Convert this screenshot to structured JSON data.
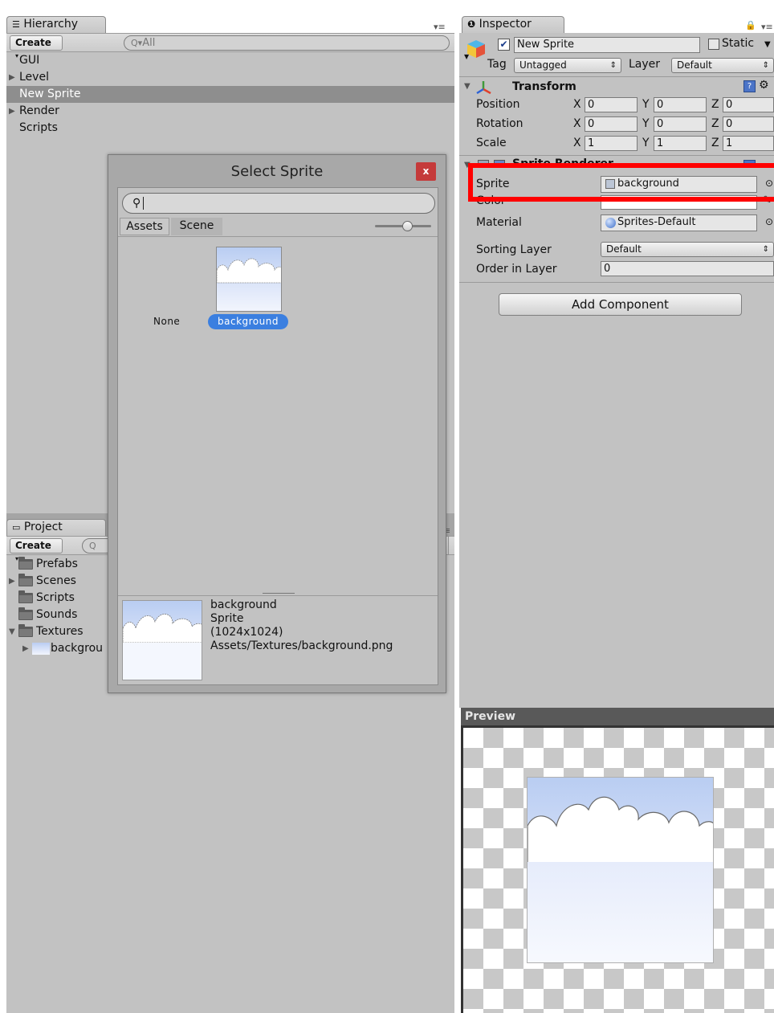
{
  "hierarchy": {
    "tab_label": "Hierarchy",
    "create_label": "Create",
    "search_placeholder": "All",
    "items": [
      {
        "label": "GUI",
        "has_children": false,
        "selected": false
      },
      {
        "label": "Level",
        "has_children": true,
        "selected": false
      },
      {
        "label": "New Sprite",
        "has_children": false,
        "selected": true
      },
      {
        "label": "Render",
        "has_children": true,
        "selected": false
      },
      {
        "label": "Scripts",
        "has_children": false,
        "selected": false
      }
    ]
  },
  "project": {
    "tab_label": "Project",
    "create_label": "Create",
    "folders": [
      {
        "label": "Prefabs",
        "expanded": null
      },
      {
        "label": "Scenes",
        "expanded": false
      },
      {
        "label": "Scripts",
        "expanded": null
      },
      {
        "label": "Sounds",
        "expanded": null
      },
      {
        "label": "Textures",
        "expanded": true
      }
    ],
    "child_asset": "backgrou"
  },
  "dialog": {
    "title": "Select Sprite",
    "close_label": "x",
    "search_value": "",
    "tabs": [
      "Assets",
      "Scene"
    ],
    "active_tab": "Scene",
    "none_label": "None",
    "selected_label": "background",
    "info": {
      "name": "background",
      "type": "Sprite",
      "size": "(1024x1024)",
      "path": "Assets/Textures/background.png"
    }
  },
  "inspector": {
    "tab_label": "Inspector",
    "object_active": true,
    "object_name": "New Sprite",
    "static_label": "Static",
    "static_checked": false,
    "tag_label": "Tag",
    "tag_value": "Untagged",
    "layer_label": "Layer",
    "layer_value": "Default",
    "transform": {
      "title": "Transform",
      "rows": [
        {
          "label": "Position",
          "x": "0",
          "y": "0",
          "z": "0"
        },
        {
          "label": "Rotation",
          "x": "0",
          "y": "0",
          "z": "0"
        },
        {
          "label": "Scale",
          "x": "1",
          "y": "1",
          "z": "1"
        }
      ]
    },
    "sprite_renderer": {
      "title": "Sprite Renderer",
      "sprite_label": "Sprite",
      "sprite_value": "background",
      "color_label": "Color",
      "material_label": "Material",
      "material_value": "Sprites-Default",
      "sorting_layer_label": "Sorting Layer",
      "sorting_layer_value": "Default",
      "order_label": "Order in Layer",
      "order_value": "0"
    },
    "add_component_label": "Add Component",
    "preview_label": "Preview"
  },
  "axis_labels": {
    "x": "X",
    "y": "Y",
    "z": "Z"
  },
  "colors": {
    "highlight_box": "#ff0000",
    "selection_pill": "#3b7fe0",
    "panel_bg": "#c2c2c2",
    "dark_header": "#595959"
  }
}
